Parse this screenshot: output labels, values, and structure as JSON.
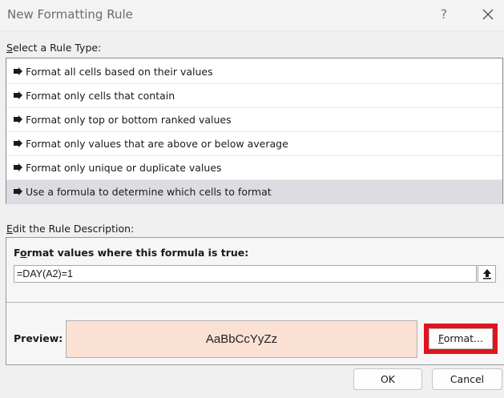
{
  "window": {
    "title": "New Formatting Rule",
    "help": "?"
  },
  "rule_type": {
    "label_mnemonic": "S",
    "label_rest": "elect a Rule Type:",
    "items": [
      {
        "label": "Format all cells based on their values",
        "selected": false
      },
      {
        "label": "Format only cells that contain",
        "selected": false
      },
      {
        "label": "Format only top or bottom ranked values",
        "selected": false
      },
      {
        "label": "Format only values that are above or below average",
        "selected": false
      },
      {
        "label": "Format only unique or duplicate values",
        "selected": false
      },
      {
        "label": "Use a formula to determine which cells to format",
        "selected": true
      }
    ]
  },
  "description": {
    "label_mnemonic": "E",
    "label_rest": "dit the Rule Description:",
    "formula_heading_pre": "F",
    "formula_heading_mnemonic": "o",
    "formula_heading_rest": "rmat values where this formula is true:",
    "formula_value": "=DAY(A2)=1",
    "preview_label": "Preview:",
    "preview_sample": "AaBbCcYyZz",
    "preview_fill": "#fbe0d4",
    "format_mnemonic": "F",
    "format_rest": "ormat...",
    "highlight_color": "#e0141e"
  },
  "buttons": {
    "ok": "OK",
    "cancel": "Cancel"
  }
}
